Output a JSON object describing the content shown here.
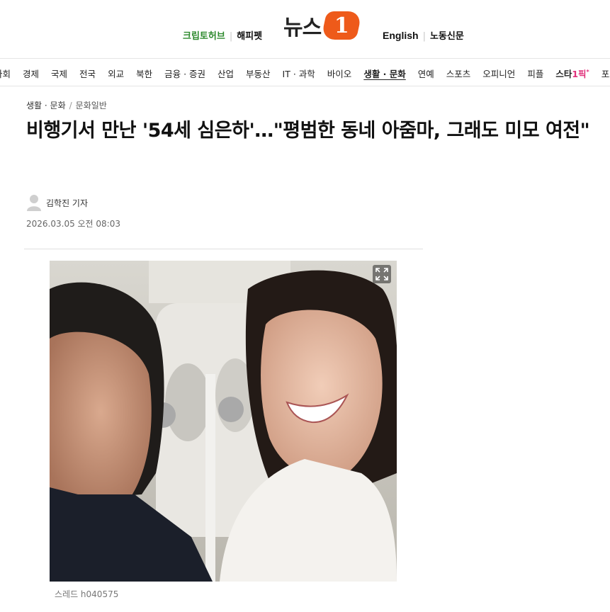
{
  "header": {
    "left_links": [
      "크립토허브",
      "해피펫"
    ],
    "logo_text": "뉴스",
    "logo_mark": "1",
    "right_links": [
      "English",
      "노동신문"
    ]
  },
  "nav": {
    "items": [
      "사회",
      "경제",
      "국제",
      "전국",
      "외교",
      "북한",
      "금융 · 증권",
      "산업",
      "부동산",
      "IT · 과학",
      "바이오",
      "생활 · 문화",
      "연예",
      "스포츠",
      "오피니언",
      "피플"
    ],
    "active": "생활 · 문화",
    "star_prefix": "스타",
    "star_pick": "1픽",
    "star_sup": "*",
    "last": "포토"
  },
  "article": {
    "breadcrumb_section": "생활 · 문화",
    "breadcrumb_sub": "문화일반",
    "headline": "비행기서 만난 '54세 심은하'…\"평범한 동네 아줌마, 그래도 미모 여전\"",
    "reporter": "김학진 기자",
    "date": "2026.03.05 오전 08:03",
    "photo_caption": "스레드 h040575"
  },
  "icons": {
    "avatar": "person-silhouette-icon",
    "expand": "expand-icon"
  },
  "colors": {
    "brand_orange": "#ee5a1a",
    "green_link": "#2e8a2e",
    "star_pink": "#e0307a"
  }
}
